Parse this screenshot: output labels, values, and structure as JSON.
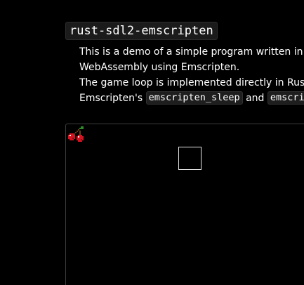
{
  "page": {
    "title": "rust-sdl2-emscripten",
    "description_lines": {
      "line1": "This is a demo of a simple program written in Rust compiled to",
      "line2": "WebAssembly using Emscripten.",
      "line3": "The game loop is implemented directly in Rust using",
      "line4_prefix": "Emscripten's ",
      "line4_code1": "emscripten_sleep",
      "line4_and": " and ",
      "line4_code2": "emscripten_set_main_loop"
    }
  },
  "game_canvas": {
    "sprite_icon": "cherry-icon",
    "player_icon": "square-outline"
  },
  "colors": {
    "background": "#000000",
    "text": "#ffffff",
    "code_bg": "#1e1e1e",
    "canvas_border": "#3c3c3c",
    "cherry_red": "#d5121f",
    "stem_brown": "#6b3b12",
    "leaf_green": "#2f8a2a",
    "player_outline": "#e6e6e6"
  }
}
